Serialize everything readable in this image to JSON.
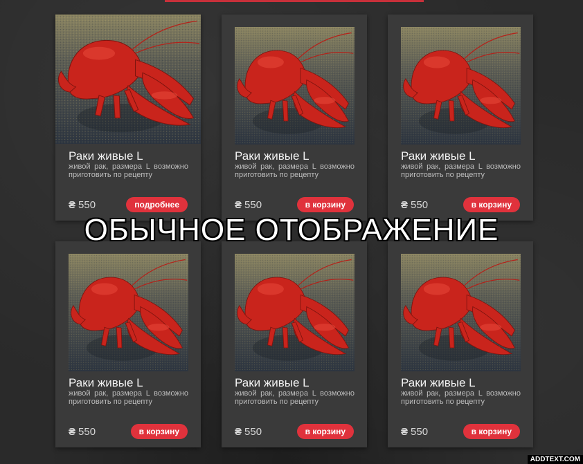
{
  "overlay_text": "ОБЫЧНОЕ ОТОБРАЖЕНИЕ",
  "watermark": "ADDTEXT.COM",
  "products": [
    {
      "title": "Раки живые L",
      "description": "живой рак, размера L возможно приготовить по рецепту",
      "currency": "₴",
      "price": "550",
      "button": "подробнее"
    },
    {
      "title": "Раки живые L",
      "description": "живой рак, размера L возможно приготовить по рецепту",
      "currency": "₴",
      "price": "550",
      "button": "в корзину"
    },
    {
      "title": "Раки живые L",
      "description": "живой рак, размера L возможно приготовить по рецепту",
      "currency": "₴",
      "price": "550",
      "button": "в корзину"
    },
    {
      "title": "Раки живые L",
      "description": "живой рак, размера L возможно приготовить по рецепту",
      "currency": "₴",
      "price": "550",
      "button": "в корзину"
    },
    {
      "title": "Раки живые L",
      "description": "живой рак, размера L возможно приготовить по рецепту",
      "currency": "₴",
      "price": "550",
      "button": "в корзину"
    },
    {
      "title": "Раки живые L",
      "description": "живой рак, размера L возможно приготовить по рецепту",
      "currency": "₴",
      "price": "550",
      "button": "в корзину"
    }
  ]
}
